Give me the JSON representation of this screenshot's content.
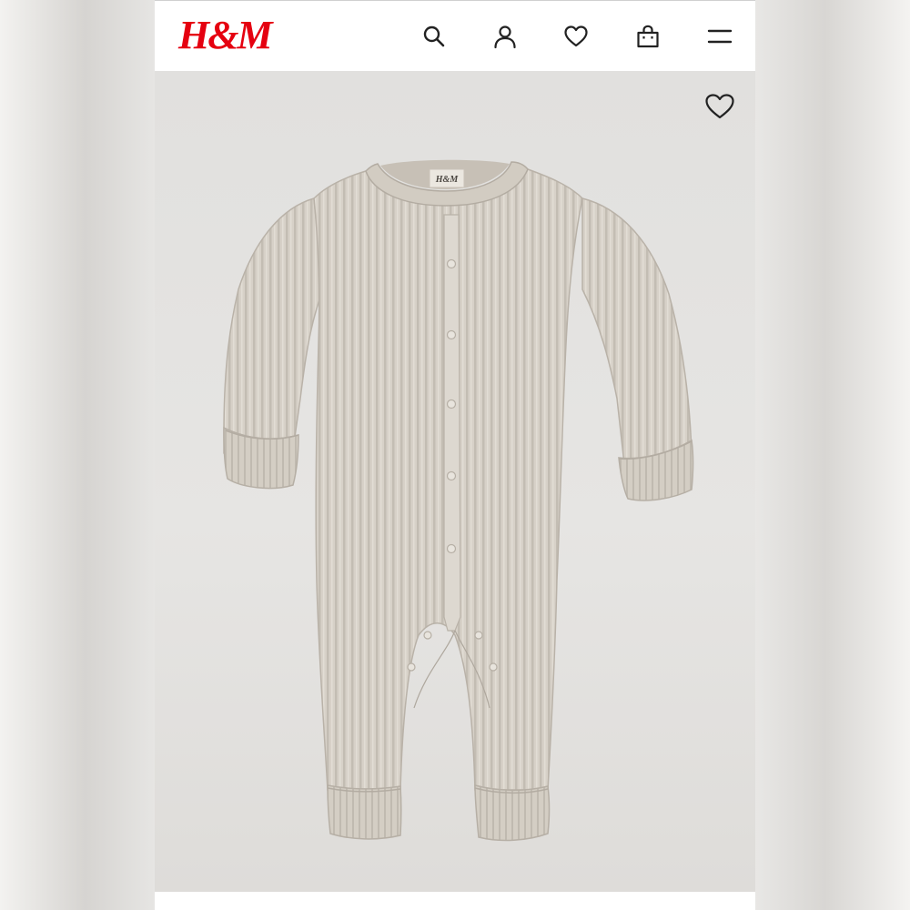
{
  "header": {
    "brand": "H&M",
    "icons": [
      "search-icon",
      "account-icon",
      "favorites-icon",
      "bag-icon",
      "menu-icon"
    ]
  },
  "product": {
    "garment_label": "H&M",
    "favorite_icon": "heart-outline-icon"
  },
  "colors": {
    "brand_red": "#e50010",
    "header_bg": "#ffffff",
    "image_bg": "#e2e1df",
    "garment": "#d6d0c6"
  }
}
